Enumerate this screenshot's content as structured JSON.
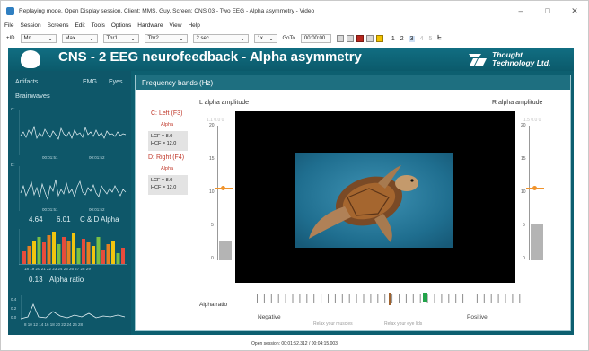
{
  "window": {
    "title": "Replaying mode. Open Display session. Client: MMS, Guy. Screen: CNS 03 - Two EEG - Alpha asymmetry - Video",
    "minimize": "–",
    "maximize": "□",
    "close": "✕"
  },
  "menu": [
    "File",
    "Session",
    "Screens",
    "Edit",
    "Tools",
    "Options",
    "Hardware",
    "View",
    "Help"
  ],
  "toolbar": {
    "mode_label": "+ID",
    "mn_value": "Mn",
    "max_value": "Max",
    "thr1_value": "Thr1",
    "thr2_value": "Thr2",
    "window_value": "2 sec",
    "speed_value": "1x",
    "goto_label": "GoTo",
    "goto_value": "00:00:00",
    "numbers": [
      "1",
      "2",
      "3",
      "4",
      "5"
    ]
  },
  "banner": {
    "title": "CNS - 2 EEG neurofeedback - Alpha asymmetry",
    "brand_line1": "Thought",
    "brand_line2": "Technology Ltd."
  },
  "left": {
    "tabs": [
      "Artifacts",
      "EMG",
      "Eyes"
    ],
    "section": "Brainwaves",
    "channel_c": "C:",
    "channel_d": "D:",
    "time_c1": "00:01:51",
    "time_c2": "00:01:52",
    "time_d1": "00:01:51",
    "time_d2": "00:01:52",
    "value_c": "4.64",
    "value_d": "6.01",
    "cd_label": "C & D Alpha",
    "bar_axis": "18 19 20 21 22 23 24 25 26 27 28 29",
    "alpha_ratio_value": "0.13",
    "alpha_ratio_label": "Alpha ratio",
    "ratio_y_labels": [
      "0.4",
      "0.2",
      "0.0"
    ],
    "ratio_axis": "8 10 12 14 16 18 20 22 24 26 28"
  },
  "panel": {
    "header": "Frequency bands (Hz)",
    "left_channel": "C: Left (F3)",
    "left_sub": "Alpha",
    "left_lcf": "LCF = 8.0",
    "left_hcf": "HCF = 12.0",
    "right_channel": "D: Right (F4)",
    "right_sub": "Alpha",
    "right_lcf": "LCF = 8.0",
    "right_hcf": "HCF = 12.0",
    "l_amp": "L alpha amplitude",
    "r_amp": "R alpha amplitude",
    "l_digits": "1.1  0.0  0",
    "r_digits": "1.5  0.0  0",
    "scale": [
      "20",
      "15",
      "10",
      "5",
      "0"
    ],
    "alpha_ratio": "Alpha ratio",
    "negative": "Negative",
    "positive": "Positive",
    "hint_left": "Relax your muscles",
    "hint_right": "Relax your eye lids"
  },
  "levels": {
    "l_amp_fraction": 0.14,
    "r_amp_fraction": 0.28,
    "l_threshold_fraction": 0.55,
    "r_threshold_fraction": 0.55,
    "ratio_marker_fraction": 0.5,
    "ratio_indicator_fraction": 0.63
  },
  "colors": {
    "teal": "#0d5f70",
    "accent_red": "#c0392b",
    "threshold": "#f0932b",
    "ratio_green": "#22a34a",
    "ratio_brown": "#a0622d"
  },
  "status": "Open session: 00:01:52.312 / 00:04:15.003"
}
